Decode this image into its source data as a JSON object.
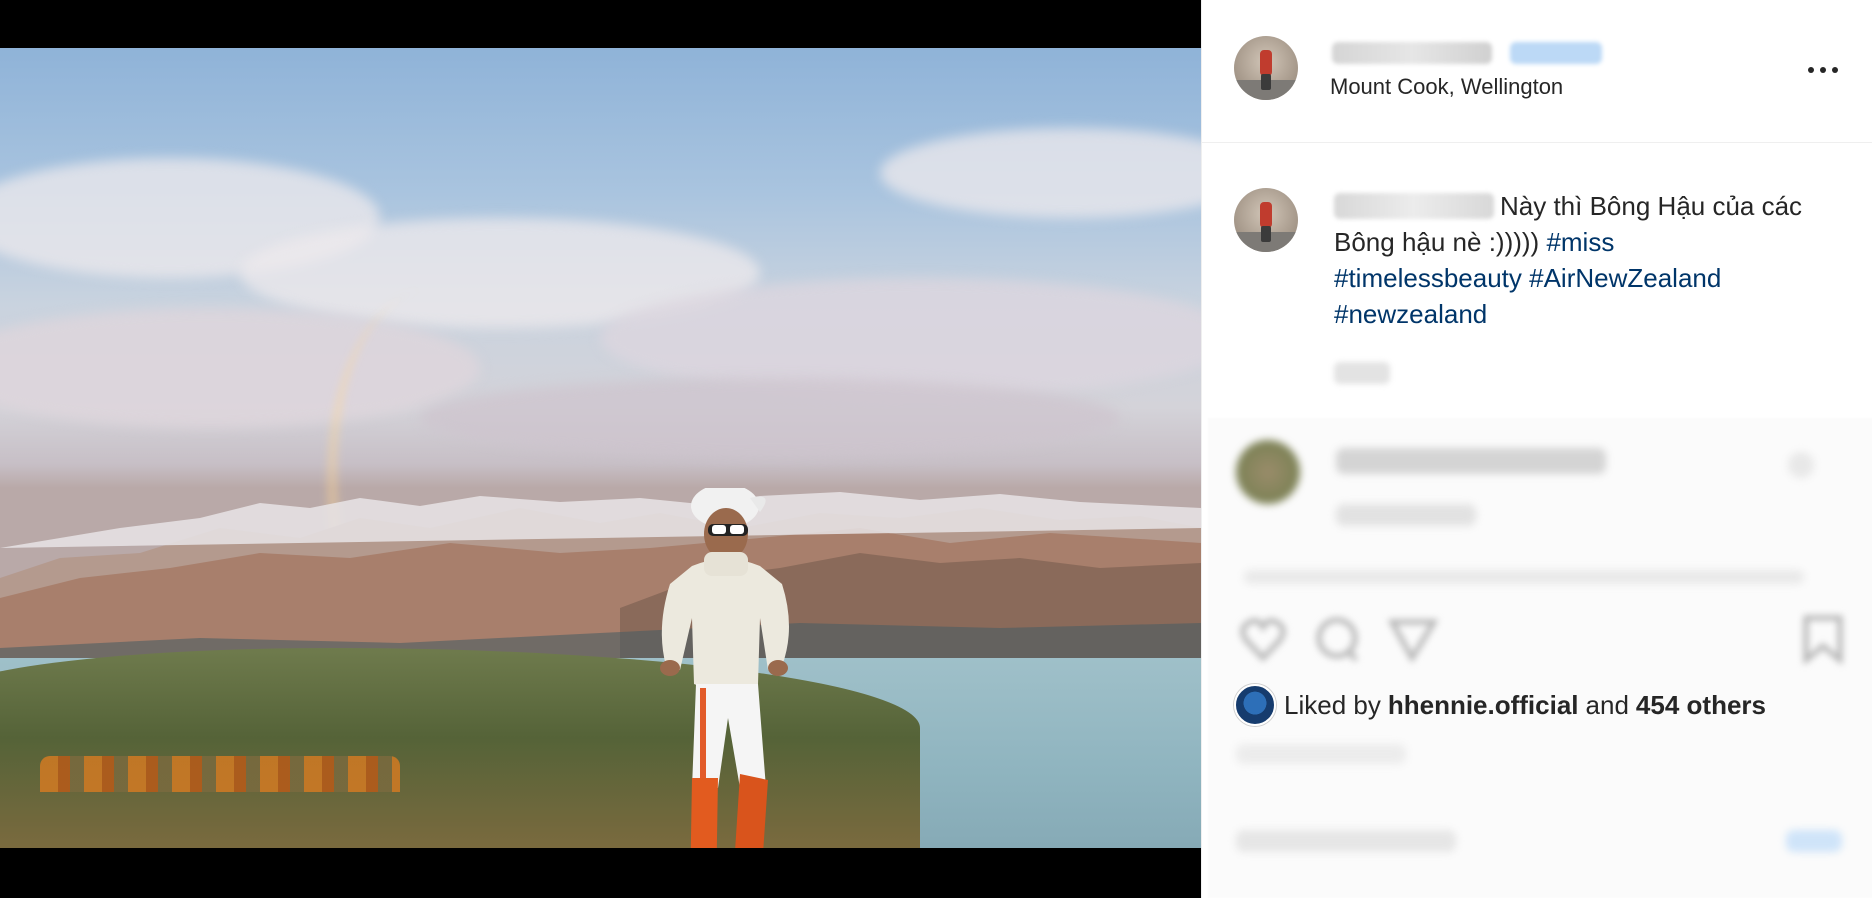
{
  "photo": {
    "alt": "Woman in white cap, sunglasses, white turtleneck and orange boots posing by a lake with mountains and a rainbow"
  },
  "post": {
    "location": "Mount Cook, Wellington",
    "username": "",
    "follow_label": "",
    "more_icon": "more-options-icon"
  },
  "caption": {
    "text": "Này thì Bông Hậu của các Bông hậu nè :))))) ",
    "hashtags": [
      "#miss",
      "#timelessbeauty",
      "#AirNewZealand",
      "#newzealand"
    ]
  },
  "actions": {
    "icons": [
      "heart-icon",
      "comment-icon",
      "share-icon",
      "bookmark-icon"
    ]
  },
  "likes": {
    "prefix": "Liked by",
    "user": "hhennie.official",
    "joiner": "and",
    "others": "454 others"
  },
  "colors": {
    "hashtag": "#003569",
    "text": "#262626",
    "border": "#efefef"
  }
}
